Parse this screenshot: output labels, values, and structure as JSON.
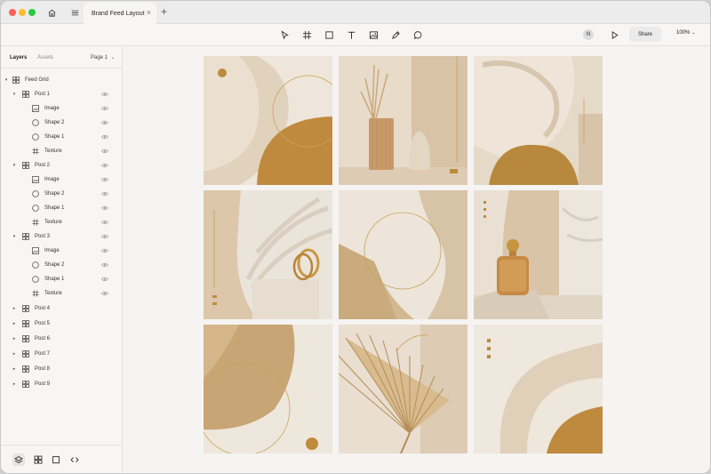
{
  "window": {
    "tab_title": "Brand Feed Layout",
    "tab_close": "×",
    "tab_add": "+"
  },
  "toolbar": {
    "avatar_initial": "N",
    "share_label": "Share",
    "zoom_label": "100%"
  },
  "sidebar": {
    "tabs": [
      "Layers",
      "Assets"
    ],
    "page_selector": "Page 1",
    "root_layer": "Feed Grid",
    "expanded_posts": [
      {
        "label": "Post 1",
        "children": [
          "Image",
          "Shape 2",
          "Shape 1",
          "Texture"
        ]
      },
      {
        "label": "Post 2",
        "children": [
          "Image",
          "Shape 2",
          "Shape 1",
          "Texture"
        ]
      },
      {
        "label": "Post 3",
        "children": [
          "Image",
          "Shape 2",
          "Shape 1",
          "Texture"
        ]
      }
    ],
    "collapsed_posts": [
      "Post 4",
      "Post 5",
      "Post 6",
      "Post 7",
      "Post 8",
      "Post 9"
    ]
  },
  "colors": {
    "accent_gold": "#c49a4a",
    "cream": "#efe7dc",
    "sand": "#d9c7ae",
    "ochre": "#c08a3e"
  },
  "icons": {
    "home": "home-icon",
    "menu": "menu-icon",
    "select": "cursor-icon",
    "frame": "frame-icon",
    "rectangle": "rectangle-icon",
    "text": "text-icon",
    "image": "image-icon",
    "pen": "pen-icon",
    "comment": "comment-icon",
    "play": "play-icon",
    "layers": "layers-icon",
    "components": "components-icon",
    "frame_view": "frame-view-icon",
    "code": "code-icon"
  }
}
